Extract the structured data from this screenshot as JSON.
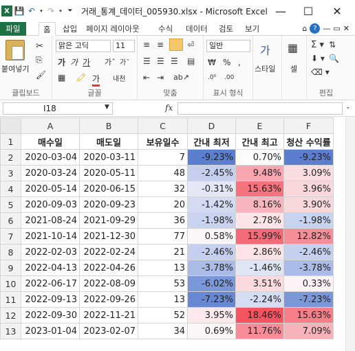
{
  "window": {
    "title": "거래_통계_데이터_005930.xlsx - Microsoft Excel",
    "minimize": "—",
    "maximize": "☐",
    "close": "✕"
  },
  "tabs": [
    {
      "label": "파일"
    },
    {
      "label": "홈"
    },
    {
      "label": "삽입"
    },
    {
      "label": "페이지 레이아웃"
    },
    {
      "label": "수식"
    },
    {
      "label": "데이터"
    },
    {
      "label": "검토"
    },
    {
      "label": "보기"
    }
  ],
  "ribbon": {
    "paste_label": "붙여넣기",
    "font_name": "맑은 고딕",
    "font_size": "11",
    "number_format": "일반",
    "style_label": "스타일",
    "cell_label": "셀",
    "groups": {
      "clipboard": "클립보드",
      "font": "글꼴",
      "alignment": "맞춤",
      "number": "표시 형식",
      "editing": "편집"
    }
  },
  "formula_bar": {
    "name_box": "I18",
    "fx": "fx",
    "formula": ""
  },
  "sheet": {
    "columns": [
      "A",
      "B",
      "C",
      "D",
      "E",
      "F"
    ],
    "headers": [
      "매수일",
      "매도일",
      "보유일수",
      "간내 최저",
      "간내 최고",
      "청산 수익률"
    ],
    "rows": [
      {
        "buy": "2020-03-04",
        "sell": "2020-03-11",
        "days": "7",
        "low": "-9.23%",
        "high": "0.70%",
        "ret": "-9.23%"
      },
      {
        "buy": "2020-03-24",
        "sell": "2020-05-11",
        "days": "48",
        "low": "-2.45%",
        "high": "9.48%",
        "ret": "3.09%"
      },
      {
        "buy": "2020-05-14",
        "sell": "2020-06-15",
        "days": "32",
        "low": "-0.31%",
        "high": "15.63%",
        "ret": "3.96%"
      },
      {
        "buy": "2020-09-03",
        "sell": "2020-09-23",
        "days": "20",
        "low": "-1.42%",
        "high": "8.16%",
        "ret": "3.90%"
      },
      {
        "buy": "2021-08-24",
        "sell": "2021-09-29",
        "days": "36",
        "low": "-1.98%",
        "high": "2.78%",
        "ret": "-1.98%"
      },
      {
        "buy": "2021-10-14",
        "sell": "2021-12-30",
        "days": "77",
        "low": "0.58%",
        "high": "15.99%",
        "ret": "12.82%"
      },
      {
        "buy": "2022-02-03",
        "sell": "2022-02-24",
        "days": "21",
        "low": "-2.46%",
        "high": "2.86%",
        "ret": "-2.46%"
      },
      {
        "buy": "2022-04-13",
        "sell": "2022-04-26",
        "days": "13",
        "low": "-3.78%",
        "high": "-1.46%",
        "ret": "-3.78%"
      },
      {
        "buy": "2022-06-17",
        "sell": "2022-08-09",
        "days": "53",
        "low": "-6.02%",
        "high": "3.51%",
        "ret": "0.33%"
      },
      {
        "buy": "2022-09-13",
        "sell": "2022-09-26",
        "days": "13",
        "low": "-7.23%",
        "high": "-2.24%",
        "ret": "-7.23%"
      },
      {
        "buy": "2022-09-30",
        "sell": "2022-11-21",
        "days": "52",
        "low": "3.95%",
        "high": "18.46%",
        "ret": "15.63%"
      },
      {
        "buy": "2023-01-04",
        "sell": "2023-02-07",
        "days": "34",
        "low": "0.69%",
        "high": "11.76%",
        "ret": "7.09%"
      }
    ],
    "cell_colors": {
      "low": [
        "#5b7fce",
        "#c4d0ee",
        "#e4e8f6",
        "#d2dbf1",
        "#c8d3ef",
        "#fbf6f8",
        "#c4d0ee",
        "#a9bbe6",
        "#7b97d8",
        "#6888d3",
        "#fbe9ec",
        "#fbf6f8"
      ],
      "high": [
        "#fcfbfc",
        "#f8a6b0",
        "#f5727f",
        "#f9b5bd",
        "#fde5e8",
        "#f36a78",
        "#fde3e6",
        "#dfe5f4",
        "#fcdadd",
        "#d5ddf2",
        "#f3545f",
        "#f88c98"
      ],
      "ret": [
        "#5b7fce",
        "#fadde0",
        "#f9d7db",
        "#f9d8dc",
        "#c8d3ef",
        "#f48f99",
        "#c4d0ee",
        "#a9bbe6",
        "#fbf2f4",
        "#7b97d8",
        "#f57e89",
        "#f7b3ba"
      ]
    }
  }
}
